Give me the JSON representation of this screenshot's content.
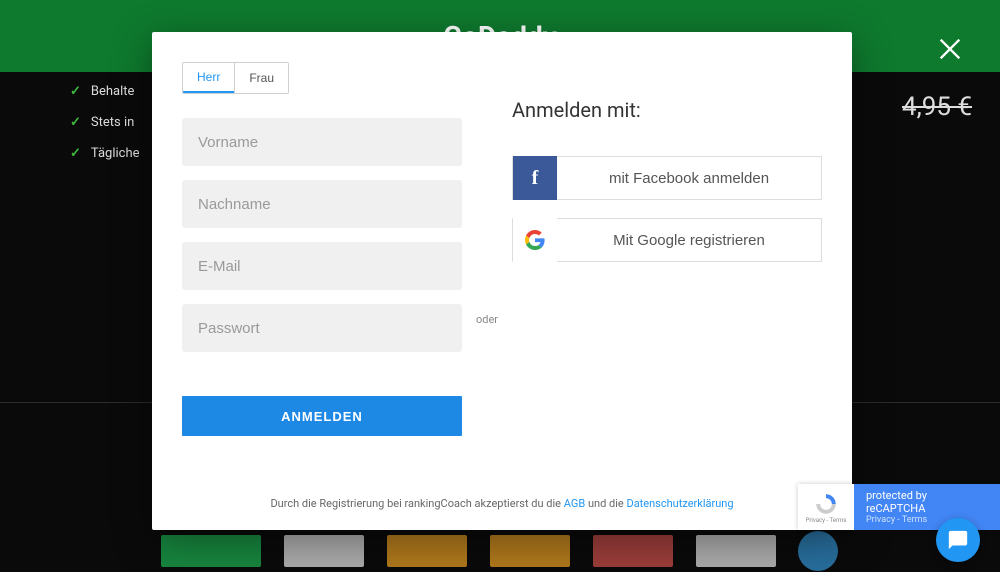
{
  "topBanner": {
    "logo": "GoDaddy"
  },
  "background": {
    "features": [
      "Behalte",
      "Stets in",
      "Tägliche"
    ],
    "price": "4,95 €"
  },
  "modal": {
    "salutation": {
      "herr": "Herr",
      "frau": "Frau"
    },
    "form": {
      "firstNamePlaceholder": "Vorname",
      "lastNamePlaceholder": "Nachname",
      "emailPlaceholder": "E-Mail",
      "passwordPlaceholder": "Passwort",
      "submitLabel": "ANMELDEN"
    },
    "divider": "oder",
    "social": {
      "heading": "Anmelden mit:",
      "facebookLabel": "mit Facebook anmelden",
      "googleLabel": "Mit Google registrieren"
    },
    "legal": {
      "prefix": "Durch die Registrierung bei rankingCoach akzeptierst du die ",
      "agbLink": "AGB",
      "middle": " und die ",
      "privacyLink": "Datenschutzerklärung"
    }
  },
  "recaptcha": {
    "protectedText": "protected by reCAPTCHA",
    "privacy": "Privacy",
    "terms": "Terms",
    "separator": " - "
  }
}
